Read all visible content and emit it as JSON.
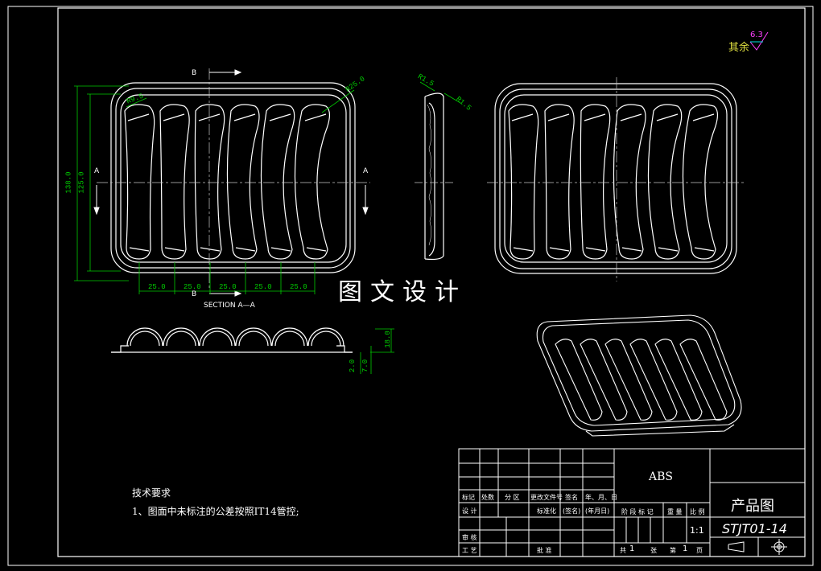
{
  "roughness": {
    "label": "其余",
    "value": "6.3"
  },
  "section_labels": {
    "b_top": "B",
    "b_bottom": "B",
    "a_left": "A",
    "a_right": "A",
    "section_title": "SECTION A—A"
  },
  "dims": {
    "width_step": "25.0",
    "height_outer": "138.0",
    "height_inner": "125.0",
    "radius_large": "R25.0",
    "radius_small": "R9.5",
    "r_corner_a": "R1.5",
    "r_corner_b": "R1.5",
    "depth": "18.0",
    "flange_a": "2.0",
    "flange_b": "7.0"
  },
  "banner": "图文设计",
  "tech_req": {
    "title": "技术要求",
    "item": "1、图面中未标注的公差按照IT14管控;"
  },
  "title_block": {
    "material": "ABS",
    "drawing_name": "产品图",
    "drawing_no": "STJT01-14",
    "scale": "1:1",
    "headers": [
      "标记",
      "处数",
      "分 区",
      "更改文件号",
      "签名",
      "年、月、日"
    ],
    "row_design": [
      "设 计",
      "标准化",
      "(签名)",
      "(年月日)"
    ],
    "row_check": "审 核",
    "row_process": "工 艺",
    "row_approve": "批 准",
    "stage_headers": [
      "阶 段 标 记",
      "重 量",
      "比 例"
    ],
    "sheets": [
      "共",
      "1",
      "张",
      "第",
      "1",
      "页"
    ]
  },
  "colors": {
    "line": "#ffffff",
    "dim": "#00cc00",
    "center": "#c8c8c8",
    "magenta": "#ff40ff",
    "yellow": "#e0e040",
    "cyan": "#00e0e0"
  }
}
